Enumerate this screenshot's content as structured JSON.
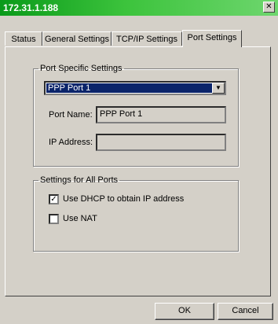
{
  "window": {
    "title": "172.31.1.188",
    "close_glyph": "✕"
  },
  "tabs": [
    "Status",
    "General Settings",
    "TCP/IP Settings",
    "Port Settings"
  ],
  "active_tab": "Port Settings",
  "port_specific": {
    "group_label": "Port Specific Settings",
    "port_select_value": "PPP Port 1",
    "port_name_label": "Port Name:",
    "port_name_value": "PPP Port 1",
    "ip_address_label": "IP Address:",
    "ip_address_value": ""
  },
  "all_ports": {
    "group_label": "Settings for All Ports",
    "use_dhcp_label": "Use DHCP to obtain IP address",
    "use_dhcp_checked": true,
    "use_nat_label": "Use NAT",
    "use_nat_checked": false
  },
  "buttons": {
    "ok": "OK",
    "cancel": "Cancel"
  },
  "colors": {
    "titlebar": "#0a9a1a",
    "selection": "#0a246a",
    "face": "#d4d0c8"
  }
}
